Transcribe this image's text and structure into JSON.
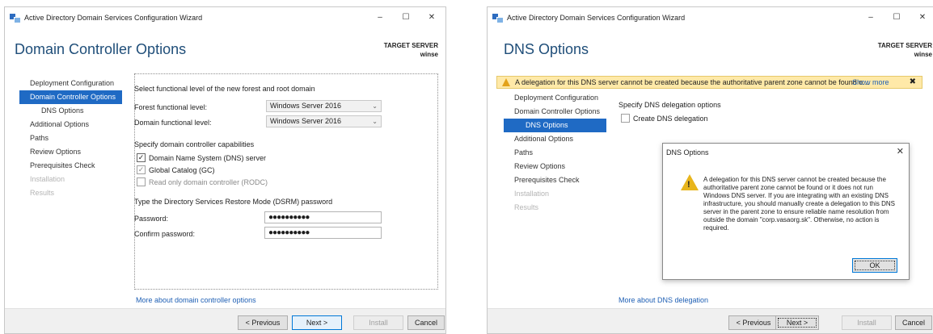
{
  "window1": {
    "title": "Active Directory Domain Services Configuration Wizard",
    "controls": {
      "minimize": "–",
      "maximize": "☐",
      "close": "✕"
    },
    "heading": "Domain Controller Options",
    "target_server_label": "TARGET SERVER",
    "target_server_name": "winse",
    "nav": [
      {
        "label": "Deployment Configuration",
        "state": "normal"
      },
      {
        "label": "Domain Controller Options",
        "state": "active"
      },
      {
        "label": "DNS Options",
        "state": "sub"
      },
      {
        "label": "Additional Options",
        "state": "normal"
      },
      {
        "label": "Paths",
        "state": "normal"
      },
      {
        "label": "Review Options",
        "state": "normal"
      },
      {
        "label": "Prerequisites Check",
        "state": "normal"
      },
      {
        "label": "Installation",
        "state": "disabled"
      },
      {
        "label": "Results",
        "state": "disabled"
      }
    ],
    "section_functional": "Select functional level of the new forest and root domain",
    "forest_label": "Forest functional level:",
    "forest_value": "Windows Server 2016",
    "domain_label": "Domain functional level:",
    "domain_value": "Windows Server 2016",
    "section_capabilities": "Specify domain controller capabilities",
    "cb_dns": "Domain Name System (DNS) server",
    "cb_gc": "Global Catalog (GC)",
    "cb_rodc": "Read only domain controller (RODC)",
    "section_dsrm": "Type the Directory Services Restore Mode (DSRM) password",
    "password_label": "Password:",
    "password_value": "●●●●●●●●●●",
    "confirm_label": "Confirm password:",
    "confirm_value": "●●●●●●●●●●",
    "more_link": "More about domain controller options",
    "buttons": {
      "previous": "< Previous",
      "next": "Next >",
      "install": "Install",
      "cancel": "Cancel"
    }
  },
  "window2": {
    "title": "Active Directory Domain Services Configuration Wizard",
    "controls": {
      "minimize": "–",
      "maximize": "☐",
      "close": "✕"
    },
    "heading": "DNS Options",
    "target_server_label": "TARGET SERVER",
    "target_server_name": "winse",
    "warning_text": "A delegation for this DNS server cannot be created because the authoritative parent zone cannot be found o...",
    "warning_more": "Show more",
    "warning_close": "✖",
    "nav": [
      {
        "label": "Deployment Configuration",
        "state": "normal"
      },
      {
        "label": "Domain Controller Options",
        "state": "normal"
      },
      {
        "label": "DNS Options",
        "state": "active-sub"
      },
      {
        "label": "Additional Options",
        "state": "normal"
      },
      {
        "label": "Paths",
        "state": "normal"
      },
      {
        "label": "Review Options",
        "state": "normal"
      },
      {
        "label": "Prerequisites Check",
        "state": "normal"
      },
      {
        "label": "Installation",
        "state": "disabled"
      },
      {
        "label": "Results",
        "state": "disabled"
      }
    ],
    "section_delegation": "Specify DNS delegation options",
    "cb_delegation": "Create DNS delegation",
    "more_link": "More about DNS delegation",
    "dialog": {
      "title": "DNS Options",
      "close": "✕",
      "message": "A delegation for this DNS server cannot be created because the authoritative parent zone cannot be found or it does not run Windows DNS server. If you are integrating with an existing DNS infrastructure, you should manually create a delegation to this DNS server in the parent zone to ensure reliable name resolution from outside the domain \"corp.vasaorg.sk\". Otherwise, no action is required.",
      "ok": "OK"
    },
    "buttons": {
      "previous": "< Previous",
      "next": "Next >",
      "install": "Install",
      "cancel": "Cancel"
    }
  }
}
